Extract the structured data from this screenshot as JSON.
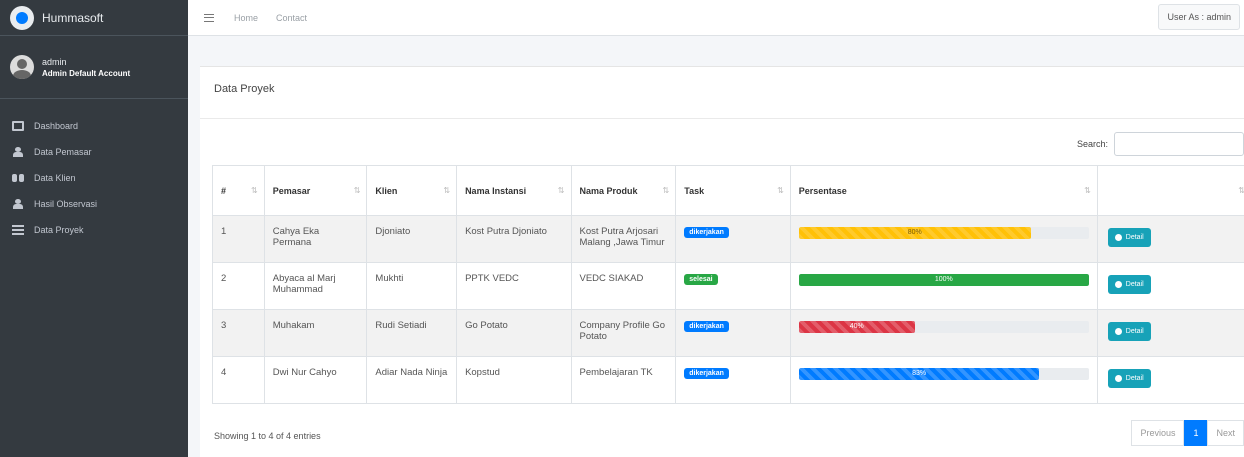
{
  "brand": {
    "name": "Hummasoft"
  },
  "user": {
    "name": "admin",
    "subtitle": "Admin Default Account"
  },
  "sidebar": {
    "items": [
      {
        "label": "Dashboard",
        "icon": "dashboard-icon"
      },
      {
        "label": "Data Pemasar",
        "icon": "user-icon"
      },
      {
        "label": "Data Klien",
        "icon": "users-icon"
      },
      {
        "label": "Hasil Observasi",
        "icon": "user-icon"
      },
      {
        "label": "Data Proyek",
        "icon": "list-icon"
      }
    ]
  },
  "topbar": {
    "home": "Home",
    "contact": "Contact",
    "user_as": "User As : admin"
  },
  "card": {
    "title": "Data Proyek",
    "search_label": "Search:"
  },
  "table": {
    "headers": [
      "#",
      "Pemasar",
      "Klien",
      "Nama Instansi",
      "Nama Produk",
      "Task",
      "Persentase",
      ""
    ],
    "rows": [
      {
        "no": "1",
        "pemasar": "Cahya Eka Permana",
        "klien": "Djoniato",
        "instansi": "Kost Putra Djoniato",
        "produk": "Kost Putra Arjosari Malang ,Jawa Timur",
        "task": "dikerjakan",
        "task_color": "#007bff",
        "percent": 80,
        "percent_label": "80%",
        "bar_class": "warning"
      },
      {
        "no": "2",
        "pemasar": "Abyaca al Marj Muhammad",
        "klien": "Mukhti",
        "instansi": "PPTK VEDC",
        "produk": "VEDC SIAKAD",
        "task": "selesai",
        "task_color": "#28a745",
        "percent": 100,
        "percent_label": "100%",
        "bar_class": "success"
      },
      {
        "no": "3",
        "pemasar": "Muhakam",
        "klien": "Rudi Setiadi",
        "instansi": "Go Potato",
        "produk": "Company Profile Go Potato",
        "task": "dikerjakan",
        "task_color": "#007bff",
        "percent": 40,
        "percent_label": "40%",
        "bar_class": "danger"
      },
      {
        "no": "4",
        "pemasar": "Dwi Nur Cahyo",
        "klien": "Adiar Nada Ninja",
        "instansi": "Kopstud",
        "produk": "Pembelajaran TK",
        "task": "dikerjakan",
        "task_color": "#007bff",
        "percent": 83,
        "percent_label": "83%",
        "bar_class": "primary"
      }
    ],
    "detail_label": "Detail"
  },
  "footer": {
    "info": "Showing 1 to 4 of 4 entries",
    "prev": "Previous",
    "page": "1",
    "next": "Next"
  }
}
